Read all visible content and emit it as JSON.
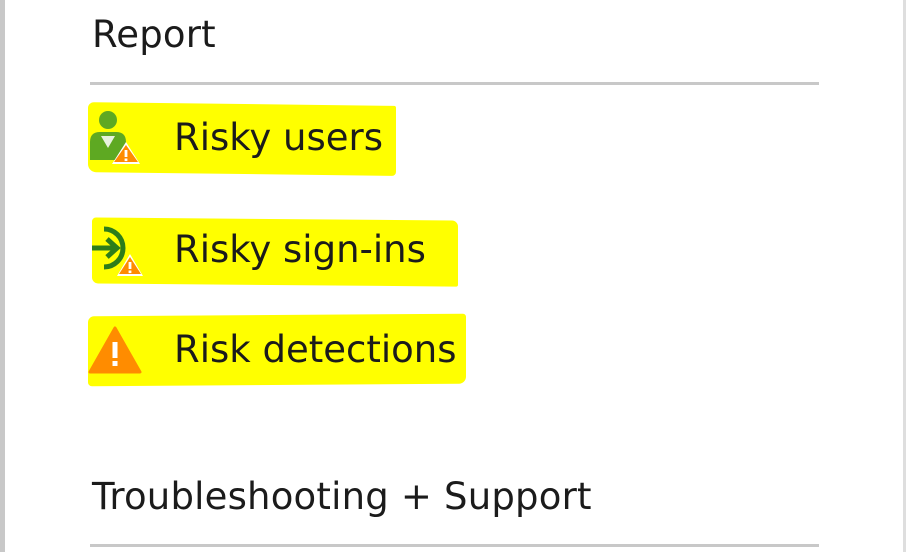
{
  "sections": {
    "report": {
      "title": "Report",
      "items": [
        {
          "label": "Risky users",
          "icon": "risky-user-icon"
        },
        {
          "label": "Risky sign-ins",
          "icon": "risky-signin-icon"
        },
        {
          "label": "Risk detections",
          "icon": "warning-icon"
        }
      ]
    },
    "troubleshooting": {
      "title": "Troubleshooting + Support"
    }
  },
  "colors": {
    "highlight": "#ffff00",
    "user_green": "#5ea922",
    "warning_orange": "#ff8c00",
    "signin_green": "#2d7d1a",
    "text": "#1b1b1b",
    "divider": "#c8c8c8"
  }
}
